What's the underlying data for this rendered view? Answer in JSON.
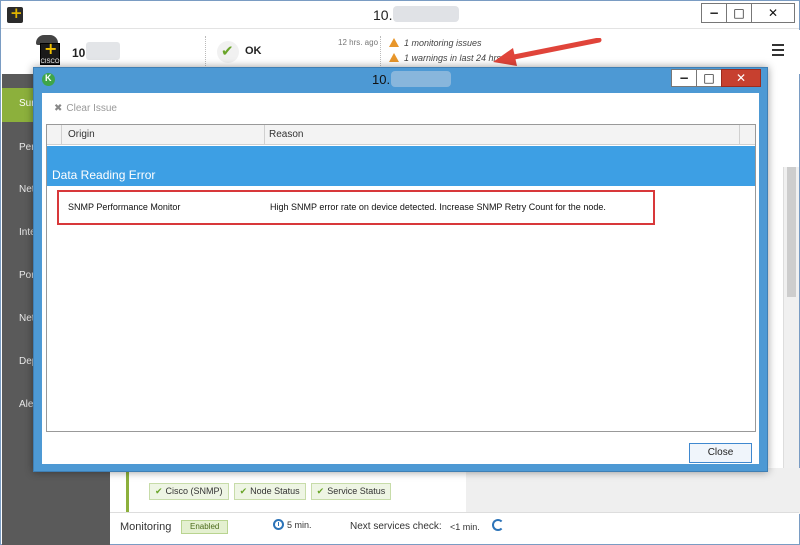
{
  "main_window": {
    "title": "10.",
    "buttons": {
      "minimize": "−",
      "maximize": "□",
      "close": "✕"
    }
  },
  "node_header": {
    "node_name": "10.",
    "status": "OK",
    "time_ago": "12 hrs. ago",
    "issues": [
      "1 monitoring issues",
      "1 warnings in last 24 hrs."
    ],
    "device_brand": "CISCO",
    "arrow_color": "#e0443a"
  },
  "left_nav": {
    "items": [
      "Sur",
      "Per",
      "Net",
      "Inte",
      "Por",
      "Net",
      "Dep",
      "Ale"
    ],
    "active_index": 0,
    "active_color": "#8cb03c"
  },
  "background_bottom": {
    "tags": [
      "Cisco (SNMP)",
      "Node Status",
      "Service Status"
    ],
    "monitoring_label": "Monitoring",
    "monitoring_state": "Enabled",
    "interval": "5 min.",
    "next_check_label": "Next services check:",
    "next_check_value": "<1 min."
  },
  "dialog": {
    "title": "10.",
    "buttons": {
      "minimize": "−",
      "maximize": "□",
      "close": "✕"
    },
    "toolbar": {
      "clear_issue": "Clear Issue"
    },
    "grid": {
      "columns": [
        "Origin",
        "Reason"
      ],
      "group": "Data Reading Error",
      "rows": [
        {
          "origin": "SNMP Performance Monitor",
          "reason": "High SNMP error rate on device detected. Increase SNMP Retry Count for the node."
        }
      ]
    },
    "close_label": "Close",
    "colors": {
      "frame": "#4d99d4",
      "group_header": "#3d9fe4",
      "highlight": "#d8383a"
    }
  }
}
